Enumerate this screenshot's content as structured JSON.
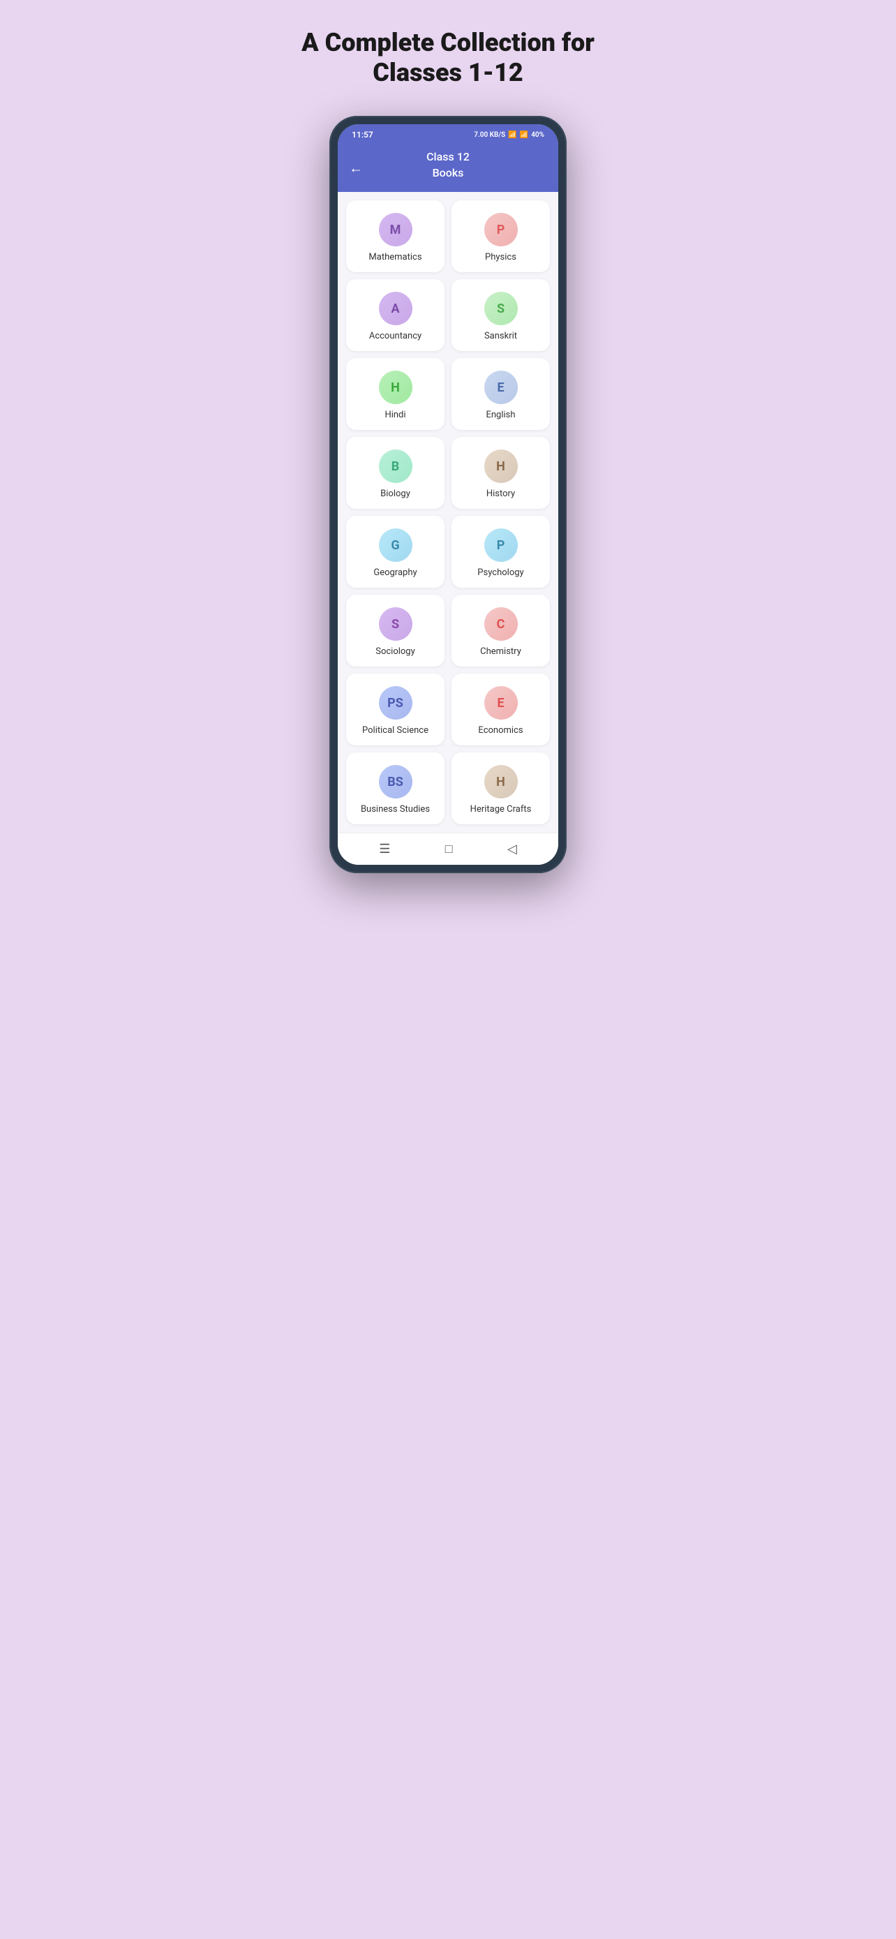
{
  "hero": {
    "title": "A Complete Collection for Classes 1-12"
  },
  "statusBar": {
    "time": "11:57",
    "speed": "7.00 KB/S",
    "battery": "40%"
  },
  "appHeader": {
    "title": "Class 12",
    "subtitle": "Books"
  },
  "subjects": [
    {
      "id": "mathematics",
      "label": "Mathematics",
      "icon": "M",
      "iconClass": "icon-math"
    },
    {
      "id": "physics",
      "label": "Physics",
      "icon": "P",
      "iconClass": "icon-physics"
    },
    {
      "id": "accountancy",
      "label": "Accountancy",
      "icon": "A",
      "iconClass": "icon-accountancy"
    },
    {
      "id": "sanskrit",
      "label": "Sanskrit",
      "icon": "S",
      "iconClass": "icon-sanskrit"
    },
    {
      "id": "hindi",
      "label": "Hindi",
      "icon": "H",
      "iconClass": "icon-hindi"
    },
    {
      "id": "english",
      "label": "English",
      "icon": "E",
      "iconClass": "icon-english"
    },
    {
      "id": "biology",
      "label": "Biology",
      "icon": "B",
      "iconClass": "icon-biology"
    },
    {
      "id": "history",
      "label": "History",
      "icon": "H",
      "iconClass": "icon-history"
    },
    {
      "id": "geography",
      "label": "Geography",
      "icon": "G",
      "iconClass": "icon-geography"
    },
    {
      "id": "psychology",
      "label": "Psychology",
      "icon": "P",
      "iconClass": "icon-psychology"
    },
    {
      "id": "sociology",
      "label": "Sociology",
      "icon": "S",
      "iconClass": "icon-sociology"
    },
    {
      "id": "chemistry",
      "label": "Chemistry",
      "icon": "C",
      "iconClass": "icon-chemistry"
    },
    {
      "id": "political-science",
      "label": "Political Science",
      "icon": "PS",
      "iconClass": "icon-polsci"
    },
    {
      "id": "economics",
      "label": "Economics",
      "icon": "E",
      "iconClass": "icon-economics"
    },
    {
      "id": "business-studies",
      "label": "Business Studies",
      "icon": "BS",
      "iconClass": "icon-business"
    },
    {
      "id": "heritage-crafts",
      "label": "Heritage Crafts",
      "icon": "H",
      "iconClass": "icon-heritage"
    }
  ]
}
